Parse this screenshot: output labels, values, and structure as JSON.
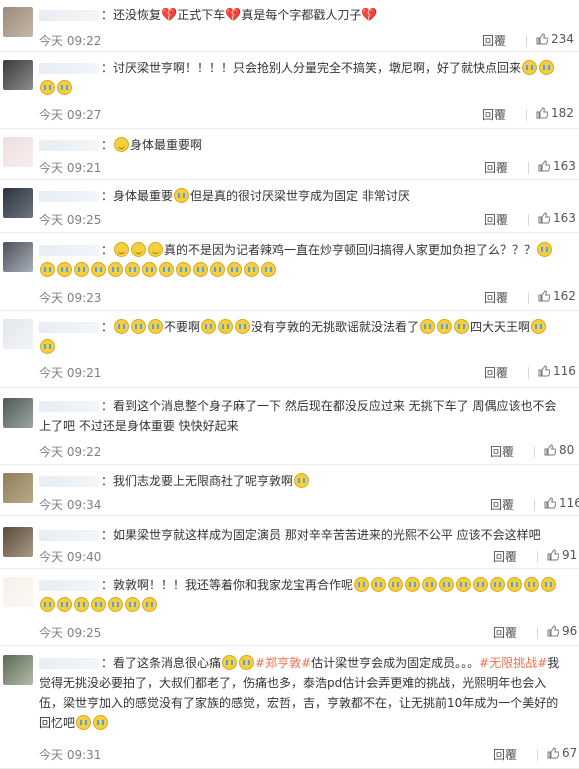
{
  "reply_label": "回覆",
  "comments": [
    {
      "text_parts": [
        "：还没恢复",
        "💔",
        "正式下车",
        "💔",
        "真是每个字都戳人刀子",
        "💔"
      ],
      "time": "今天 09:22",
      "likes": "234"
    },
    {
      "text_parts": [
        "：讨厌梁世亨啊！！！！只会抢别人分量完全不搞笑，墩尼啊，好了就快点回来",
        "[泪]",
        "[泪]",
        "[泪]",
        "[泪]"
      ],
      "time": "今天 09:27",
      "likes": "182"
    },
    {
      "text_parts": [
        "：",
        "[可怜]",
        "身体最重要啊"
      ],
      "time": "今天 09:21",
      "likes": "163"
    },
    {
      "text_parts": [
        "：身体最重要",
        "[泪]",
        "但是真的很讨厌梁世亨成为固定 非常讨厌"
      ],
      "time": "今天 09:25",
      "likes": "163"
    },
    {
      "text_parts": [
        "：",
        "[笑]",
        "[笑]",
        "[笑]",
        "真的不是因为记者辣鸡一直在炒亨顿回归搞得人家更加负担了么？？？",
        "[泪]",
        "[泪]",
        "[泪]",
        "[泪]",
        "[泪]",
        "[泪]",
        "[泪]",
        "[泪]",
        "[泪]",
        "[泪]",
        "[泪]",
        "[泪]",
        "[泪]",
        "[泪]",
        "[泪]"
      ],
      "time": "今天 09:23",
      "likes": "162"
    },
    {
      "text_parts": [
        "：",
        "[泪]",
        "[泪]",
        "[泪]",
        "不要啊",
        "[泪]",
        "[泪]",
        "[泪]",
        "没有亨敦的无挑歌谣就没法看了",
        "[泪]",
        "[泪]",
        "[泪]",
        "四大天王啊",
        "[泪]",
        "[泪]"
      ],
      "time": "今天 09:21",
      "likes": "116"
    },
    {
      "text_parts": [
        "：看到这个消息整个身子麻了一下 然后现在都没反应过来  无挑下车了 周偶应该也不会上了吧 不过还是身体重要 快快好起来"
      ],
      "time": "今天 09:22",
      "likes": "80"
    },
    {
      "text_parts": [
        "：我们志龙要上无限商社了呢亨敦啊",
        "[哭]"
      ],
      "time": "今天 09:34",
      "likes": "116"
    },
    {
      "text_parts": [
        "：如果梁世亨就这样成为固定演员 那对辛辛苦苦进来的光熙不公平  应该不会这样吧"
      ],
      "time": "今天 09:40",
      "likes": "91"
    },
    {
      "text_parts": [
        "：敦敦啊！！！我还等着你和我家龙宝再合作呢",
        "[泪]",
        "[泪]",
        "[泪]",
        "[泪]",
        "[泪]",
        "[泪]",
        "[泪]",
        "[泪]",
        "[泪]",
        "[泪]",
        "[泪]",
        "[泪]",
        "[泪]",
        "[泪]",
        "[泪]",
        "[泪]",
        "[泪]",
        "[泪]",
        "[泪]"
      ],
      "time": "今天 09:25",
      "likes": "96"
    },
    {
      "text_parts": [
        "：看了这条消息很心痛",
        "[泪]",
        "[泪]",
        "#郑亨敦#",
        "估计梁世亨会成为固定成员。。。",
        "#无限挑战#",
        "我觉得无挑没必要拍了，大叔们都老了，伤痛也多，泰浩pd估计会弄更难的挑战，光熙明年也会入伍，梁世亨加入的感觉没有了家族的感觉，宏哲，吉，亨敦都不在，让无挑前10年成为一个美好的回忆吧",
        "[泪]",
        "[泪]"
      ],
      "time": "今天 09:31",
      "likes": "67"
    }
  ]
}
